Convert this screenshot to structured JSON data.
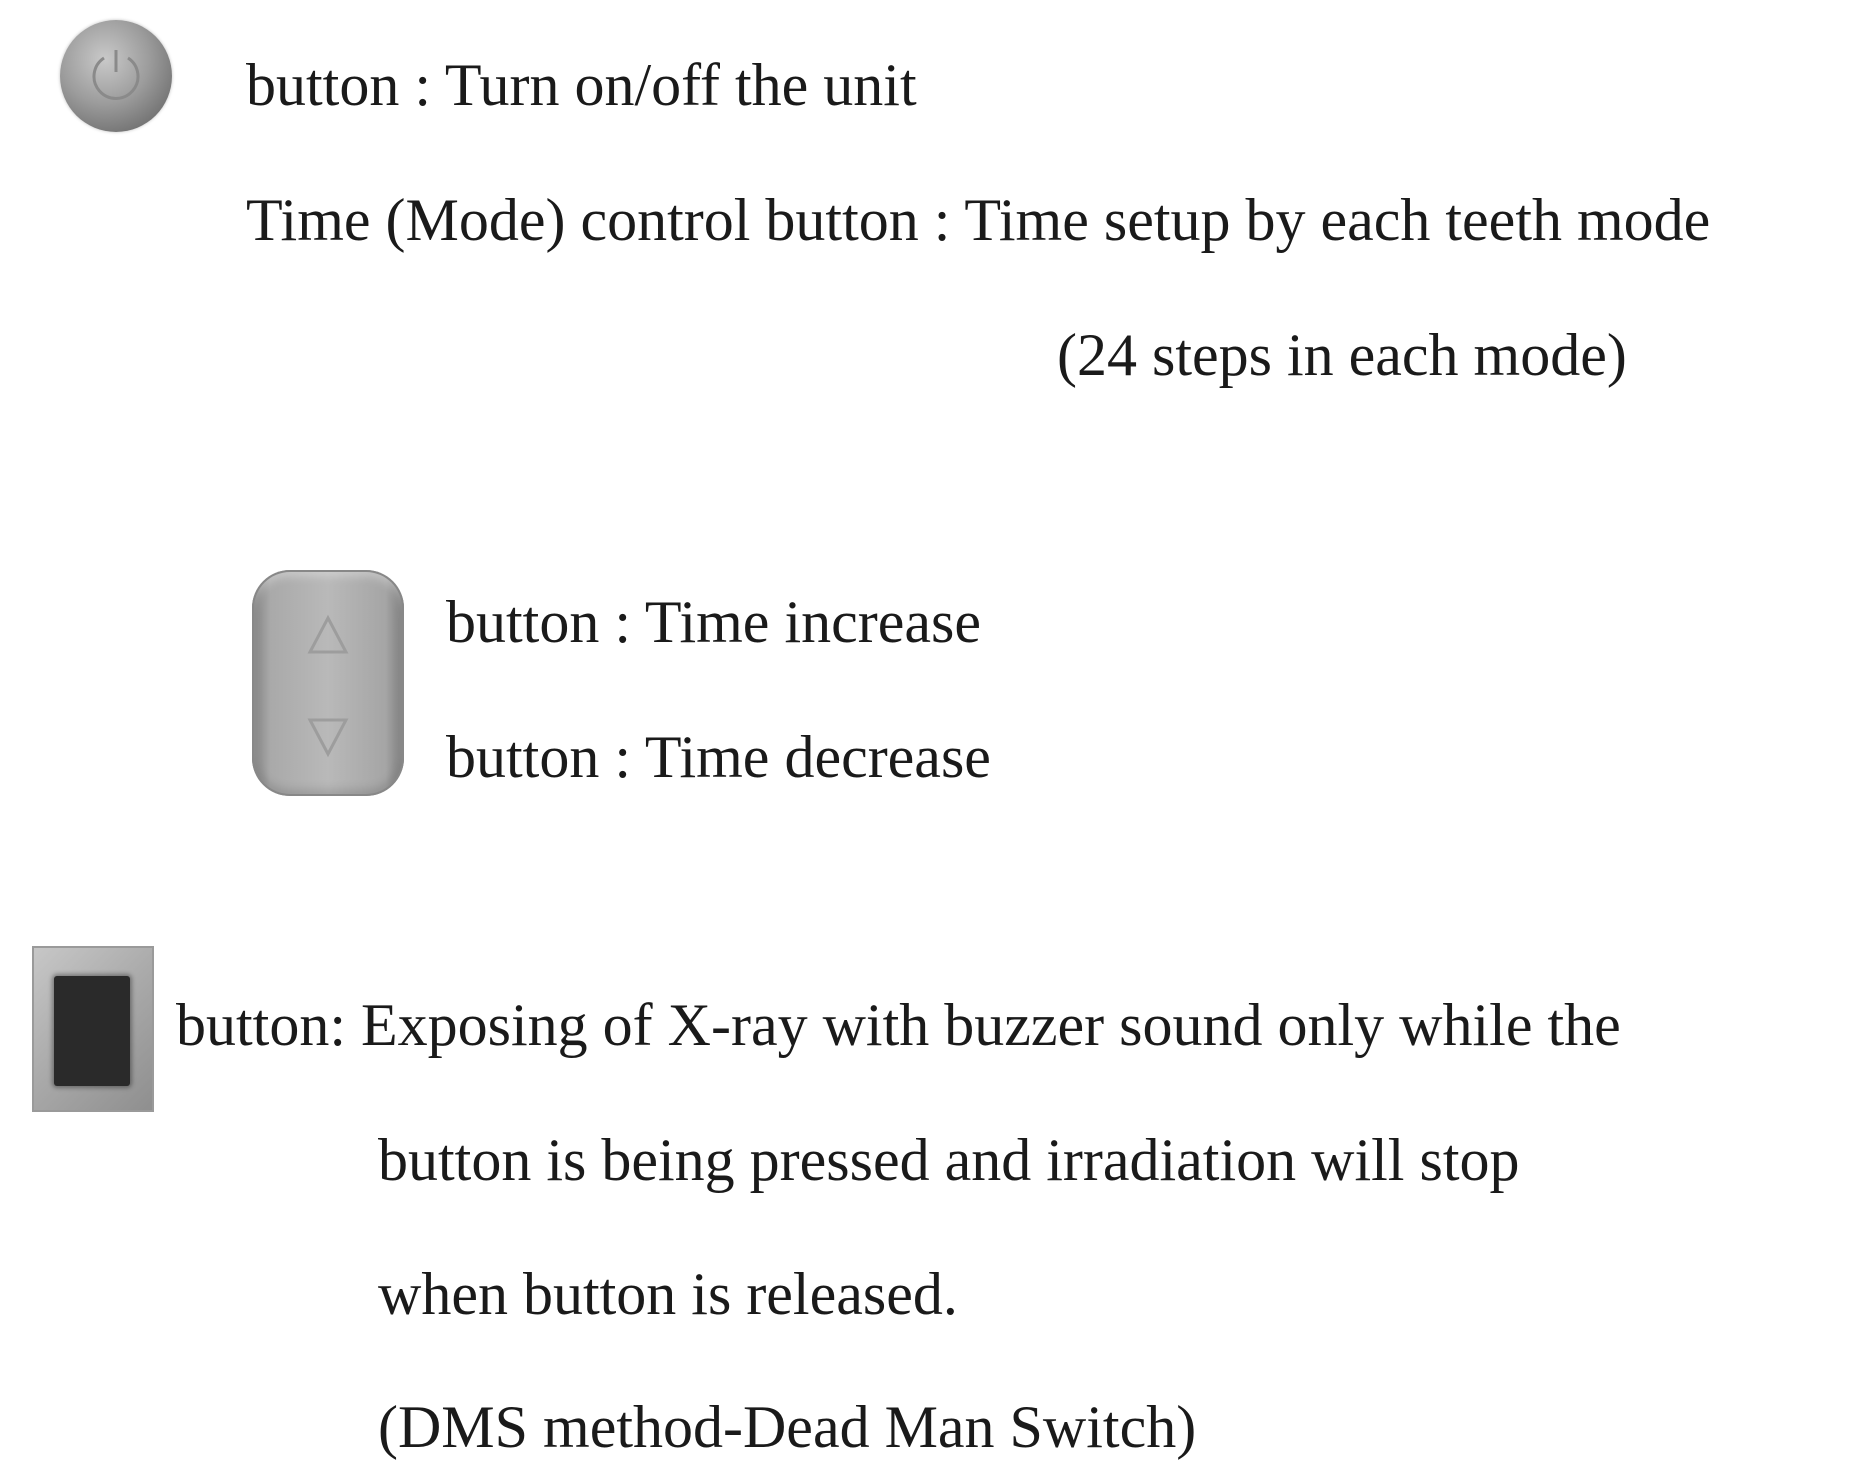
{
  "power": {
    "icon": "power-button-icon",
    "text": "button : Turn on/off the unit"
  },
  "mode": {
    "line1": "Time (Mode) control button : Time setup by each teeth mode",
    "line2": "(24 steps in each mode)"
  },
  "time_adjust": {
    "icon": "up-down-button-icon",
    "increase": "button : Time increase",
    "decrease": "button : Time decrease"
  },
  "exposure": {
    "icon": "xray-exposure-button-icon",
    "line1": "button: Exposing of X-ray  with buzzer sound only while  the",
    "line2": "button is being pressed and irradiation will stop",
    "line3": "when button is released.",
    "line4": "(DMS  method-Dead Man Switch)"
  }
}
